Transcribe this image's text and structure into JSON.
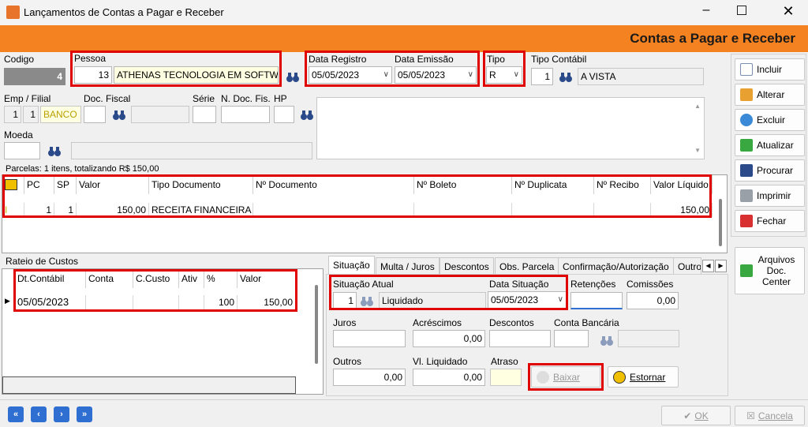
{
  "window": {
    "title": "Lançamentos de Contas a Pagar e Receber"
  },
  "banner": {
    "title": "Contas a Pagar e Receber"
  },
  "header": {
    "codigo_label": "Codigo",
    "codigo_value": "4",
    "pessoa_label": "Pessoa",
    "pessoa_id": "13",
    "pessoa_name": "ATHENAS TECNOLOGIA EM SOFTWA",
    "data_registro_label": "Data Registro",
    "data_registro_value": "05/05/2023",
    "data_emissao_label": "Data Emissão",
    "data_emissao_value": "05/05/2023",
    "tipo_label": "Tipo",
    "tipo_value": "R",
    "tipo_contabil_label": "Tipo Contábil",
    "tipo_contabil_id": "1",
    "tipo_contabil_name": "A VISTA",
    "emp_label": "Emp / Filial",
    "emp_value": "1",
    "filial_value": "1",
    "emp_name": "BANCO I",
    "doc_fiscal_label": "Doc. Fiscal",
    "serie_label": "Série",
    "n_doc_label": "N. Doc. Fis.",
    "hp_label": "HP",
    "moeda_label": "Moeda"
  },
  "parcelas": {
    "summary": "Parcelas: 1 itens, totalizando R$ 150,00",
    "columns": [
      "PC",
      "SP",
      "Valor",
      "Tipo Documento",
      "Nº Documento",
      "Nº Boleto",
      "Nº Duplicata",
      "Nº Recibo",
      "Valor Líquido"
    ],
    "rows": [
      {
        "flag": "I",
        "pc": "1",
        "sp": "1",
        "valor": "150,00",
        "tipo": "RECEITA FINANCEIRA",
        "doc": "",
        "boleto": "",
        "duplicata": "",
        "recibo": "",
        "liquido": "150,00"
      }
    ]
  },
  "rateio": {
    "title": "Rateio de Custos",
    "columns": [
      "Dt.Contábil",
      "Conta",
      "C.Custo",
      "Ativ",
      "%",
      "Valor"
    ],
    "rows": [
      {
        "dt": "05/05/2023",
        "conta": "",
        "ccusto": "",
        "ativ": "",
        "pct": "100",
        "valor": "150,00"
      }
    ]
  },
  "tabs": [
    "Situação",
    "Multa / Juros",
    "Descontos",
    "Obs. Parcela",
    "Confirmação/Autorização",
    "Outro"
  ],
  "situacao": {
    "atual_label": "Situação Atual",
    "atual_id": "1",
    "atual_name": "Liquidado",
    "data_label": "Data Situação",
    "data_value": "05/05/2023",
    "retencoes_label": "Retenções",
    "comissoes_label": "Comissões",
    "comissoes_value": "0,00",
    "juros_label": "Juros",
    "acrescimos_label": "Acréscimos",
    "acrescimos_value": "0,00",
    "descontos_label": "Descontos",
    "conta_label": "Conta Bancária",
    "outros_label": "Outros",
    "outros_value": "0,00",
    "liquidado_label": "Vl. Liquidado",
    "liquidado_value": "0,00",
    "atraso_label": "Atraso",
    "baixar_label": "Baixar",
    "estornar_label": "Estornar"
  },
  "actions": {
    "incluir": "Incluir",
    "alterar": "Alterar",
    "excluir": "Excluir",
    "atualizar": "Atualizar",
    "procurar": "Procurar",
    "imprimir": "Imprimir",
    "fechar": "Fechar",
    "arquivos_l1": "Arquivos",
    "arquivos_l2": "Doc.",
    "arquivos_l3": "Center"
  },
  "footer": {
    "ok": "OK",
    "cancela": "Cancela"
  },
  "colors": {
    "banner": "#f58220",
    "highlight": "#e00000",
    "nav": "#2f6fd1"
  }
}
